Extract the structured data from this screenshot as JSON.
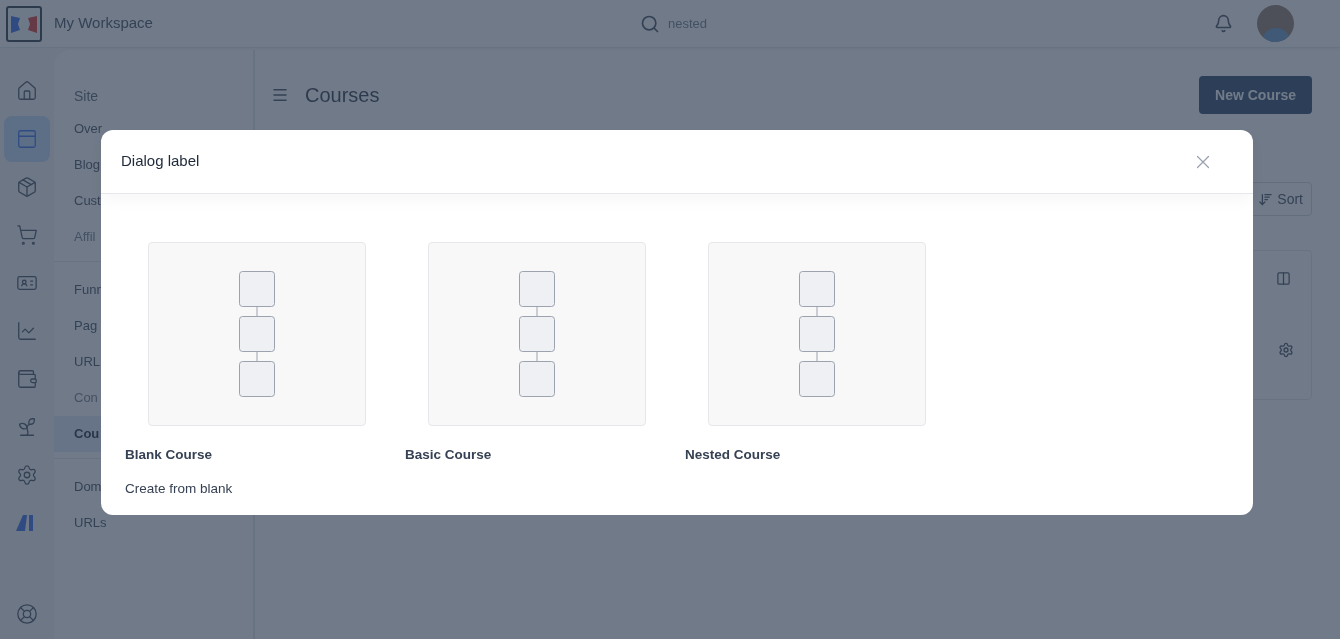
{
  "top_bar": {
    "workspace_name": "My Workspace",
    "search": {
      "value": "nested"
    }
  },
  "rail": {
    "items": [
      {
        "selected": false
      },
      {
        "selected": true
      },
      {
        "selected": false
      },
      {
        "selected": false
      },
      {
        "selected": false
      },
      {
        "selected": false
      },
      {
        "selected": false
      },
      {
        "selected": false
      },
      {
        "selected": false
      },
      {
        "selected": false
      }
    ]
  },
  "sidebar": {
    "heading": "Site",
    "sections": [
      {
        "items": [
          {
            "label": "Over",
            "selected": false,
            "disabled": false
          },
          {
            "label": "Blog",
            "selected": false,
            "disabled": false
          },
          {
            "label": "Cust",
            "selected": false,
            "disabled": false
          },
          {
            "label": "Affil",
            "selected": false,
            "disabled": true
          }
        ]
      },
      {
        "items": [
          {
            "label": "Funn",
            "selected": false,
            "disabled": false
          },
          {
            "label": "Pag",
            "selected": false,
            "disabled": false
          },
          {
            "label": "URL",
            "selected": false,
            "disabled": false
          },
          {
            "label": "Con",
            "selected": false,
            "disabled": true
          },
          {
            "label": "Cou",
            "selected": true,
            "disabled": false
          }
        ]
      },
      {
        "items": [
          {
            "label": "Dom",
            "selected": false,
            "disabled": false
          },
          {
            "label": "URLs",
            "selected": false,
            "disabled": false
          }
        ]
      }
    ]
  },
  "main": {
    "title": "Courses",
    "new_button": "New Course",
    "sort_button": "Sort"
  },
  "dialog": {
    "title": "Dialog label",
    "options": [
      {
        "title": "Blank Course",
        "description": "Create from blank"
      },
      {
        "title": "Basic Course"
      },
      {
        "title": "Nested Course"
      }
    ]
  }
}
